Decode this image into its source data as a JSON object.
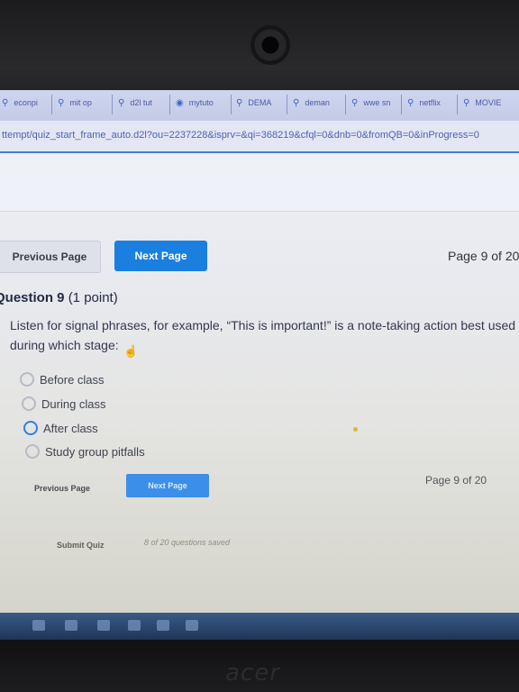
{
  "bookmarks": [
    {
      "label": "econpi",
      "icon": "search-icon"
    },
    {
      "label": "mit op",
      "icon": "search-icon"
    },
    {
      "label": "d2l tut",
      "icon": "search-icon"
    },
    {
      "label": "mytuto",
      "icon": "app-icon"
    },
    {
      "label": "DEMA",
      "icon": "search-icon"
    },
    {
      "label": "deman",
      "icon": "search-icon"
    },
    {
      "label": "wwe sn",
      "icon": "search-icon"
    },
    {
      "label": "netflix",
      "icon": "search-icon"
    },
    {
      "label": "MOVIE",
      "icon": "search-icon"
    }
  ],
  "url": "ttempt/quiz_start_frame_auto.d2l?ou=2237228&isprv=&qi=368219&cfql=0&dnb=0&fromQB=0&inProgress=0",
  "nav": {
    "previous": "Previous Page",
    "next": "Next Page",
    "page_indicator": "Page 9 of 20"
  },
  "question": {
    "title": "Question 9",
    "points": "(1 point)",
    "text": "Listen for signal phrases, for example, “This is important!” is a note-taking action best used during which stage:",
    "options": [
      "Before class",
      "During class",
      "After class",
      "Study group pitfalls"
    ],
    "selected_index": 2
  },
  "nav_bottom": {
    "previous": "Previous Page",
    "next": "Next Page",
    "page_indicator": "Page 9 of 20"
  },
  "footer": {
    "submit": "Submit Quiz",
    "saved_status": "8 of 20 questions saved"
  },
  "device": {
    "brand": "acer"
  },
  "colors": {
    "accent": "#1b7fe0",
    "selected_radio": "#2f80da"
  }
}
